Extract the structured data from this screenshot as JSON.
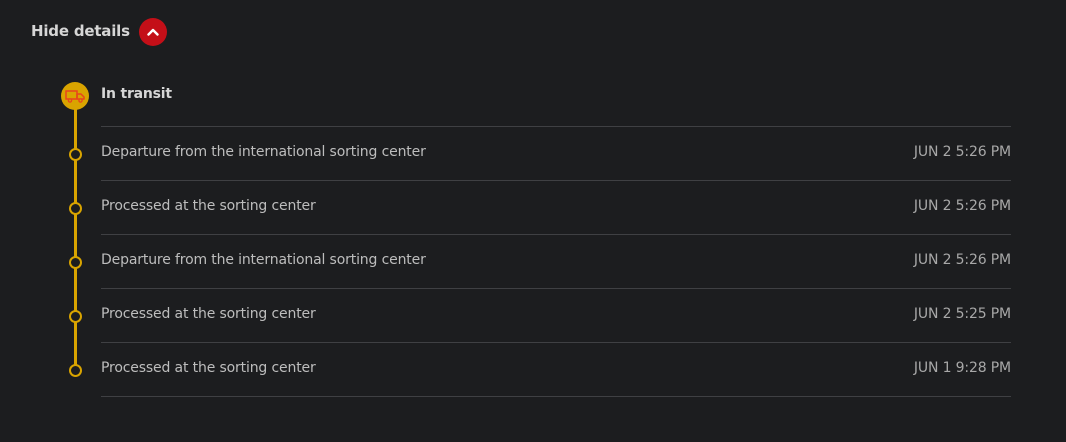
{
  "toggle": {
    "label": "Hide details",
    "icon": "chevron-up-icon",
    "button_color": "#c40f18"
  },
  "status": {
    "title": "In transit",
    "icon": "truck-icon",
    "accent_color": "#d9a400"
  },
  "events": [
    {
      "text": "Departure from the international sorting center",
      "time": "JUN 2 5:26 PM"
    },
    {
      "text": "Processed at the sorting center",
      "time": "JUN 2 5:26 PM"
    },
    {
      "text": "Departure from the international sorting center",
      "time": "JUN 2 5:26 PM"
    },
    {
      "text": "Processed at the sorting center",
      "time": "JUN 2 5:25 PM"
    },
    {
      "text": "Processed at the sorting center",
      "time": "JUN 1 9:28 PM"
    }
  ]
}
